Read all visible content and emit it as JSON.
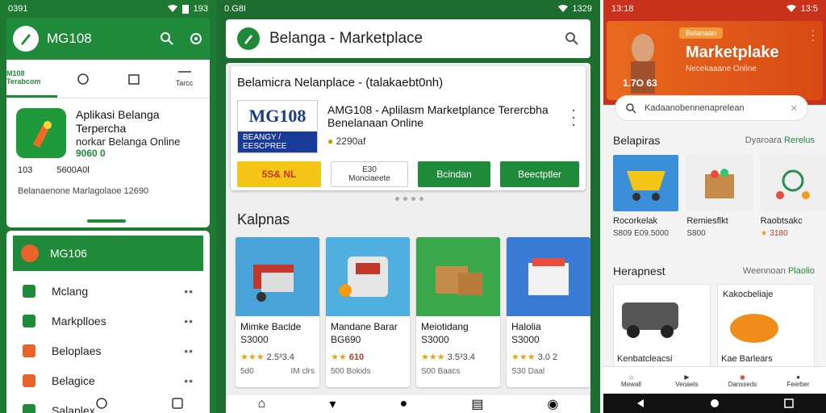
{
  "phone1": {
    "status": {
      "time": "0391",
      "battery": "193"
    },
    "appbar": {
      "title": "MG108"
    },
    "tabs": [
      {
        "label": "M108 Terabcom"
      },
      {
        "label": ""
      },
      {
        "label": ""
      },
      {
        "label": "Tarcc"
      }
    ],
    "card": {
      "line1": "Aplikasi Belanga",
      "line2": "Terpercha",
      "line3": "norkar Belanga Online",
      "line4": "9060 0",
      "meta_left": "103",
      "meta_right": "5600A0l"
    },
    "description": "Belanaenone Marlagolaoe 12690",
    "sheet": {
      "title": "MG106",
      "items": [
        {
          "label": "Mclang",
          "color": "#1f8a3a"
        },
        {
          "label": "Markplloes",
          "color": "#1f8a3a"
        },
        {
          "label": "Beloplaes",
          "color": "#e8642a"
        },
        {
          "label": "Belagice",
          "color": "#e8642a"
        },
        {
          "label": "Salaplex",
          "color": "#1f8a3a"
        }
      ]
    }
  },
  "phone2": {
    "status": {
      "time": "0.G8I",
      "battery": "1329"
    },
    "search": {
      "title": "Belanga - Marketplace"
    },
    "appcard": {
      "heading": "Belamicra Nelanplace - (talakaebt0nh)",
      "banner_logo": "MG108",
      "banner_sub": "BEANGY / EESCPREE",
      "title": "AMG108 - Aplilasm Marketplance Terercbha",
      "subtitle": "Benelanaan Online",
      "rating": "2290af",
      "buttons": {
        "yellow": "5S& NL",
        "white_top": "E30",
        "white_bottom": "Monciaeete",
        "green1": "Bcindan",
        "green2": "Beectptler"
      }
    },
    "section_title": "Kalpnas",
    "products": [
      {
        "name": "Mimke Baclde",
        "price": "S3000",
        "rating": "2.5³3.4",
        "sold": "5d0",
        "sold2": "IM clrs"
      },
      {
        "name": "Mandane Barar",
        "price": "BG690",
        "rating": "610",
        "sold": "500 Bokids",
        "sold2": ""
      },
      {
        "name": "Meiotidang",
        "price": "S3000",
        "rating": "3.5³3.4",
        "sold": "S00 Baacs",
        "sold2": ""
      },
      {
        "name": "Halolia",
        "price": "S3000",
        "rating": "3.0 2",
        "sold": "S30 Daal",
        "sold2": ""
      }
    ]
  },
  "phone3": {
    "status": {
      "time": "13:18",
      "battery": "13:5"
    },
    "hero": {
      "pill": "Belanaan",
      "title": "Marketplake",
      "subtitle": "Necekaaane Online",
      "badge": "1.7O 63"
    },
    "search": {
      "placeholder": "Kadaanobennenaprelean"
    },
    "section1": {
      "title": "Belapiras",
      "right_gray": "Dyaroara",
      "right_green": "Rerelus"
    },
    "tiles": [
      {
        "name": "Rocorkelak",
        "price": "S809 E09.5000"
      },
      {
        "name": "Remiesflkt",
        "price": "S800"
      },
      {
        "name": "Raobtsakc",
        "price": "3180"
      }
    ],
    "section2": {
      "title": "Herapnest",
      "right_gray": "Weennoan",
      "right_green": "Plaolio"
    },
    "tiles2": [
      {
        "name": "Kenbatcleacsi"
      },
      {
        "name": "Kae Barlears",
        "top": "Kakocbeliaje"
      }
    ],
    "nav": [
      {
        "label": "Mewall"
      },
      {
        "label": "Veoaels"
      },
      {
        "label": "Dansseds"
      },
      {
        "label": "Feerber"
      }
    ]
  }
}
